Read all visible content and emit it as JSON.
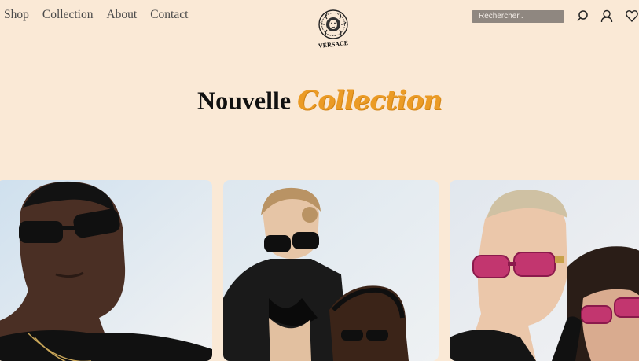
{
  "nav": {
    "items": [
      {
        "label": "Shop"
      },
      {
        "label": "Collection"
      },
      {
        "label": "About"
      },
      {
        "label": "Contact"
      }
    ]
  },
  "brand": {
    "logo_text": "VERSACE"
  },
  "search": {
    "placeholder": "Rechercher.."
  },
  "header_icons": [
    "search-icon",
    "user-icon",
    "heart-icon"
  ],
  "hero": {
    "title_main": "Nouvelle",
    "title_accent": "Collection"
  },
  "colors": {
    "background": "#fae9d6",
    "accent": "#eb9b25",
    "search_bg": "#8f8780"
  },
  "products": [
    {
      "description": "man with black rectangular sunglasses"
    },
    {
      "description": "woman with black sunglasses and crochet top"
    },
    {
      "description": "couple with pink tinted sunglasses"
    }
  ]
}
